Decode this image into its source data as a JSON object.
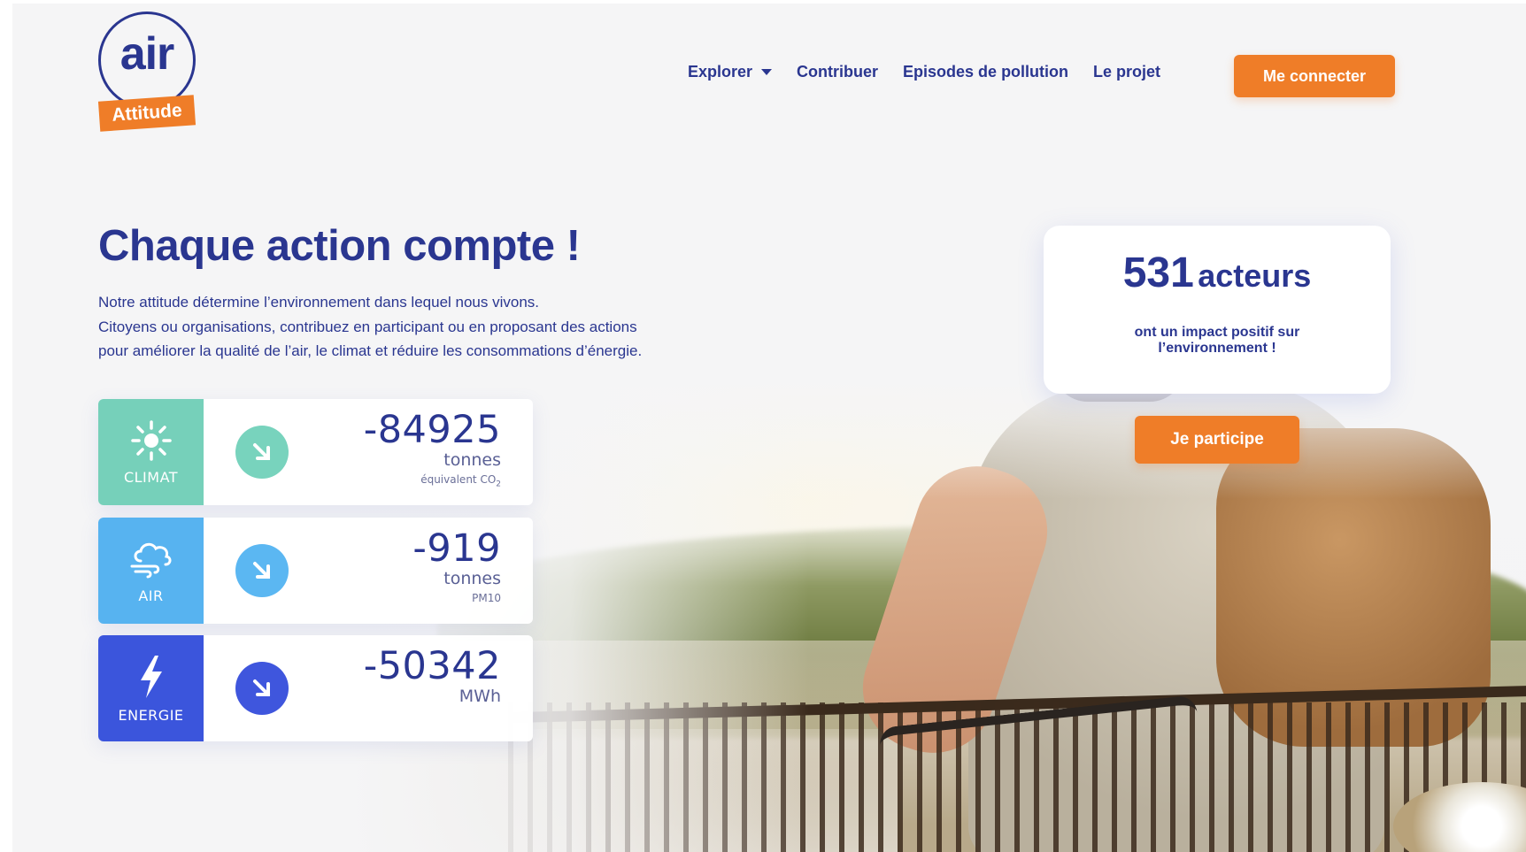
{
  "logo": {
    "word": "air",
    "badge": "Attitude"
  },
  "nav": {
    "items": [
      {
        "label": "Explorer",
        "dropdown": true
      },
      {
        "label": "Contribuer"
      },
      {
        "label": "Episodes de pollution"
      },
      {
        "label": "Le projet"
      }
    ],
    "login_label": "Me connecter"
  },
  "hero": {
    "title": "Chaque action compte !",
    "lines": [
      "Notre attitude détermine l’environnement dans lequel nous vivons.",
      "Citoyens ou organisations, contribuez en participant ou en proposant des actions",
      "pour améliorer la qualité de l’air, le climat et réduire les consommations d’énergie."
    ]
  },
  "stats": [
    {
      "label": "CLIMAT",
      "icon": "sun-icon",
      "color": "#76d0ba",
      "value": "-84925",
      "unit": "tonnes",
      "sub": "équivalent CO",
      "sub_suffix": "2"
    },
    {
      "label": "AIR",
      "icon": "wind-cloud-icon",
      "color": "#57b3f0",
      "value": "-919",
      "unit": "tonnes",
      "sub": "PM10"
    },
    {
      "label": "ENERGIE",
      "icon": "lightning-icon",
      "color": "#3b55dc",
      "value": "-50342",
      "unit": "MWh"
    }
  ],
  "actors": {
    "count": "531",
    "word": "acteurs",
    "text": "ont un impact positif sur l’environnement !"
  },
  "cta": {
    "label": "Je participe"
  },
  "colors": {
    "primary": "#2a3690",
    "accent": "#ef7d28"
  }
}
